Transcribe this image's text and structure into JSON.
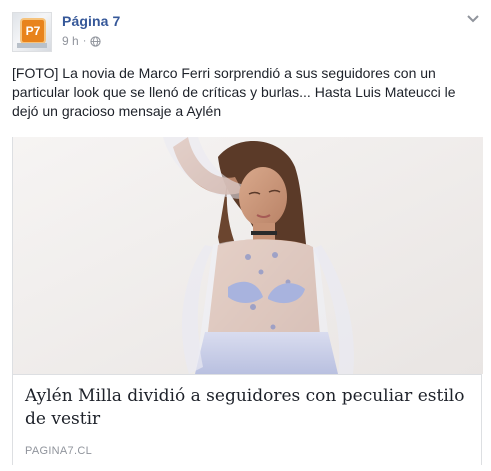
{
  "post": {
    "page_name": "Página 7",
    "avatar_text": "P7",
    "time": "9 h",
    "separator": "·",
    "visibility_icon": "globe-icon",
    "menu_icon": "chevron-down-icon",
    "message": "[FOTO] La novia de Marco Ferri sorprendió a sus seguidores con un particular look que se llenó de críticas y burlas... Hasta Luis Mateucci le dejó un gracioso mensaje a Aylén"
  },
  "link_card": {
    "title": "Aylén Milla dividió a seguidores con peculiar estilo de vestir",
    "domain": "PAGINA7.CL"
  },
  "colors": {
    "link_blue": "#365899",
    "meta_gray": "#90949c",
    "text": "#1d2129",
    "border": "#dddfe2",
    "logo_orange": "#e8831c"
  }
}
